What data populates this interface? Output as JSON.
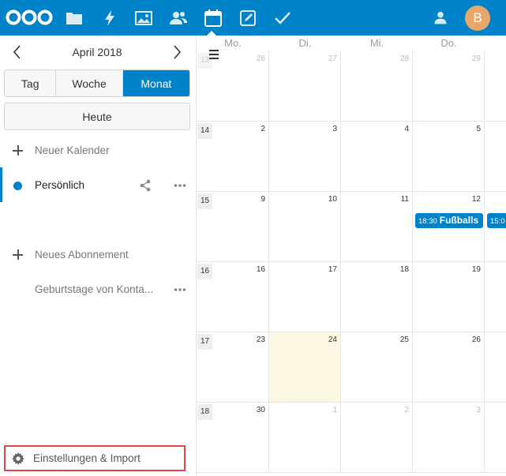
{
  "header": {
    "apps": [
      {
        "name": "files-icon"
      },
      {
        "name": "activity-icon"
      },
      {
        "name": "gallery-icon"
      },
      {
        "name": "contacts-icon"
      },
      {
        "name": "calendar-icon"
      },
      {
        "name": "notes-icon"
      },
      {
        "name": "tasks-icon"
      }
    ],
    "avatar_initial": "B",
    "colors": {
      "bar": "#0082c9",
      "avatar": "#e9a76b"
    }
  },
  "sidebar": {
    "month_label": "April 2018",
    "views": {
      "day": "Tag",
      "week": "Woche",
      "month": "Monat"
    },
    "today_label": "Heute",
    "new_calendar_label": "Neuer Kalender",
    "calendar_name": "Persönlich",
    "new_subscription_label": "Neues Abonnement",
    "birthdays_label": "Geburtstage von Konta...",
    "settings_label": "Einstellungen & Import"
  },
  "calendar": {
    "weekdays": [
      "Mo.",
      "Di.",
      "Mi.",
      "Do."
    ],
    "weeks": [
      {
        "weeknum": "13",
        "weeknum_faded": true,
        "days": [
          "26",
          "27",
          "28",
          "29",
          ""
        ],
        "other": [
          true,
          true,
          true,
          true,
          true
        ]
      },
      {
        "weeknum": "14",
        "weeknum_faded": false,
        "days": [
          "2",
          "3",
          "4",
          "5",
          ""
        ],
        "other": [
          false,
          false,
          false,
          false,
          false
        ]
      },
      {
        "weeknum": "15",
        "weeknum_faded": false,
        "days": [
          "9",
          "10",
          "11",
          "12",
          ""
        ],
        "other": [
          false,
          false,
          false,
          false,
          false
        ]
      },
      {
        "weeknum": "16",
        "weeknum_faded": false,
        "days": [
          "16",
          "17",
          "18",
          "19",
          ""
        ],
        "other": [
          false,
          false,
          false,
          false,
          false
        ]
      },
      {
        "weeknum": "17",
        "weeknum_faded": false,
        "days": [
          "23",
          "24",
          "25",
          "26",
          ""
        ],
        "other": [
          false,
          false,
          false,
          false,
          false
        ]
      },
      {
        "weeknum": "18",
        "weeknum_faded": false,
        "days": [
          "30",
          "1",
          "2",
          "3",
          ""
        ],
        "other": [
          false,
          true,
          true,
          true,
          true
        ]
      }
    ],
    "today": "24",
    "events": [
      {
        "time": "18:30",
        "title": "Fußballs",
        "day": "12"
      },
      {
        "time": "15:0",
        "title": "",
        "day": "13"
      }
    ]
  }
}
